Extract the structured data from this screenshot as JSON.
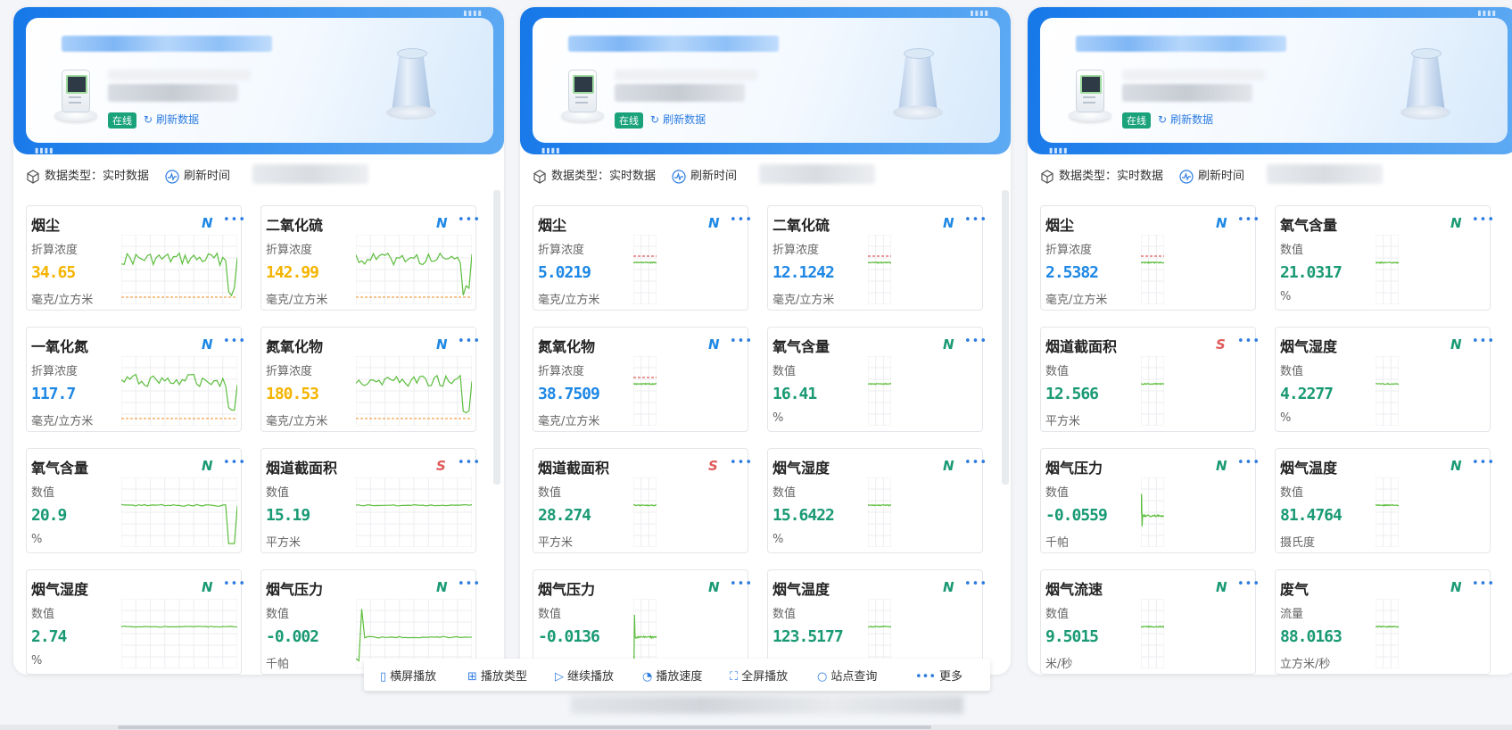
{
  "colors": {
    "primary": "#1677e8",
    "green": "#1aa27a",
    "blue_value": "#1e88e5",
    "yellow_value": "#f4b400",
    "green_value": "#1a9a74",
    "red_flag": "#e05a5a"
  },
  "banner": {
    "status_label": "在线",
    "refresh_label": "刷新数据"
  },
  "info_bar": {
    "type_label": "数据类型：实时数据",
    "time_label": "刷新时间"
  },
  "panels": [
    {
      "cards": [
        {
          "name": "烟尘",
          "flag": "N",
          "type": "折算浓度",
          "value": "34.65",
          "unit": "毫克/立方米"
        },
        {
          "name": "二氧化硫",
          "flag": "N",
          "type": "折算浓度",
          "value": "142.99",
          "unit": "毫克/立方米"
        },
        {
          "name": "一氧化氮",
          "flag": "N",
          "type": "折算浓度",
          "value": "117.7",
          "unit": "毫克/立方米"
        },
        {
          "name": "氮氧化物",
          "flag": "N",
          "type": "折算浓度",
          "value": "180.53",
          "unit": "毫克/立方米"
        },
        {
          "name": "氧气含量",
          "flag": "N",
          "type": "数值",
          "value": "20.9",
          "unit": "%"
        },
        {
          "name": "烟道截面积",
          "flag": "S",
          "type": "数值",
          "value": "15.19",
          "unit": "平方米"
        },
        {
          "name": "烟气湿度",
          "flag": "N",
          "type": "数值",
          "value": "2.74",
          "unit": "%"
        },
        {
          "name": "烟气压力",
          "flag": "N",
          "type": "数值",
          "value": "-0.002",
          "unit": "千帕"
        }
      ]
    },
    {
      "cards": [
        {
          "name": "烟尘",
          "flag": "N",
          "type": "折算浓度",
          "value": "5.0219",
          "unit": "毫克/立方米"
        },
        {
          "name": "二氧化硫",
          "flag": "N",
          "type": "折算浓度",
          "value": "12.1242",
          "unit": "毫克/立方米"
        },
        {
          "name": "氮氧化物",
          "flag": "N",
          "type": "折算浓度",
          "value": "38.7509",
          "unit": "毫克/立方米"
        },
        {
          "name": "氧气含量",
          "flag": "N",
          "type": "数值",
          "value": "16.41",
          "unit": "%"
        },
        {
          "name": "烟道截面积",
          "flag": "S",
          "type": "数值",
          "value": "28.274",
          "unit": "平方米"
        },
        {
          "name": "烟气湿度",
          "flag": "N",
          "type": "数值",
          "value": "15.6422",
          "unit": "%"
        },
        {
          "name": "烟气压力",
          "flag": "N",
          "type": "数值",
          "value": "-0.0136",
          "unit": ""
        },
        {
          "name": "烟气温度",
          "flag": "N",
          "type": "数值",
          "value": "123.5177",
          "unit": ""
        }
      ]
    },
    {
      "cards": [
        {
          "name": "烟尘",
          "flag": "N",
          "type": "折算浓度",
          "value": "2.5382",
          "unit": "毫克/立方米"
        },
        {
          "name": "氧气含量",
          "flag": "N",
          "type": "数值",
          "value": "21.0317",
          "unit": "%"
        },
        {
          "name": "烟道截面积",
          "flag": "S",
          "type": "数值",
          "value": "12.566",
          "unit": "平方米"
        },
        {
          "name": "烟气湿度",
          "flag": "N",
          "type": "数值",
          "value": "4.2277",
          "unit": "%"
        },
        {
          "name": "烟气压力",
          "flag": "N",
          "type": "数值",
          "value": "-0.0559",
          "unit": "千帕"
        },
        {
          "name": "烟气温度",
          "flag": "N",
          "type": "数值",
          "value": "81.4764",
          "unit": "摄氏度"
        },
        {
          "name": "烟气流速",
          "flag": "N",
          "type": "数值",
          "value": "9.5015",
          "unit": "米/秒"
        },
        {
          "name": "废气",
          "flag": "N",
          "type": "流量",
          "value": "88.0163",
          "unit": "立方米/秒"
        }
      ]
    }
  ],
  "toolbar": {
    "landscape": "横屏播放",
    "play_type": "播放类型",
    "continue": "继续播放",
    "speed": "播放速度",
    "fullscreen": "全屏播放",
    "station_query": "站点查询",
    "more": "更多"
  }
}
